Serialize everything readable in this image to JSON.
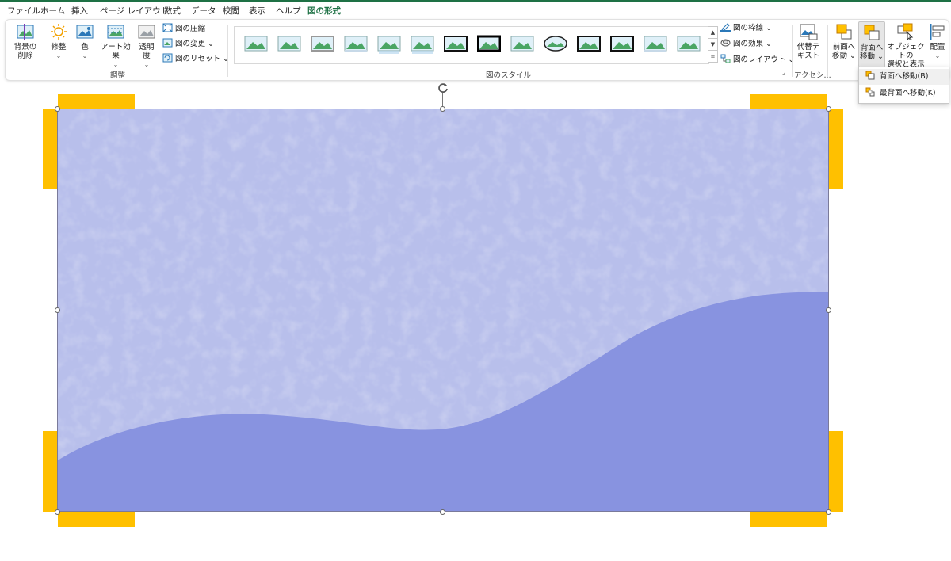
{
  "tabs": [
    {
      "label": "ファイル",
      "active": false
    },
    {
      "label": "ホーム",
      "active": false
    },
    {
      "label": "挿入",
      "active": false
    },
    {
      "label": "ページ レイアウト",
      "active": false
    },
    {
      "label": "数式",
      "active": false
    },
    {
      "label": "データ",
      "active": false
    },
    {
      "label": "校閲",
      "active": false
    },
    {
      "label": "表示",
      "active": false
    },
    {
      "label": "ヘルプ",
      "active": false
    },
    {
      "label": "図の形式",
      "active": true
    }
  ],
  "adjust_group": {
    "label": "調整",
    "remove_bg_l1": "背景の",
    "remove_bg_l2": "削除",
    "corrections": "修整",
    "color": "色",
    "artistic": "アート効果",
    "transparency_l1": "透明",
    "transparency_l2": "度",
    "compress": "図の圧縮",
    "change": "図の変更",
    "reset": "図のリセット"
  },
  "styles_group": {
    "label": "図のスタイル",
    "thumb_count": 14,
    "border": "図の枠線",
    "effects": "図の効果",
    "layout": "図のレイアウト"
  },
  "access_group": {
    "label": "アクセシ...",
    "alt_text_l1": "代替テ",
    "alt_text_l2": "キスト"
  },
  "arrange_group": {
    "bring_forward_l1": "前面へ",
    "bring_forward_l2": "移動",
    "send_backward_l1": "背面へ",
    "send_backward_l2": "移動",
    "selection_l1": "オブジェクトの",
    "selection_l2": "選択と表示",
    "align": "配置"
  },
  "dropdown": {
    "items": [
      {
        "label": "背面へ移動(B)"
      },
      {
        "label": "最背面へ移動(K)"
      }
    ]
  },
  "colors": {
    "accent_green": "#1e7145",
    "picture_light": "#b8bfeb",
    "picture_wave": "#8893e0",
    "brackets": "#ffc000"
  }
}
